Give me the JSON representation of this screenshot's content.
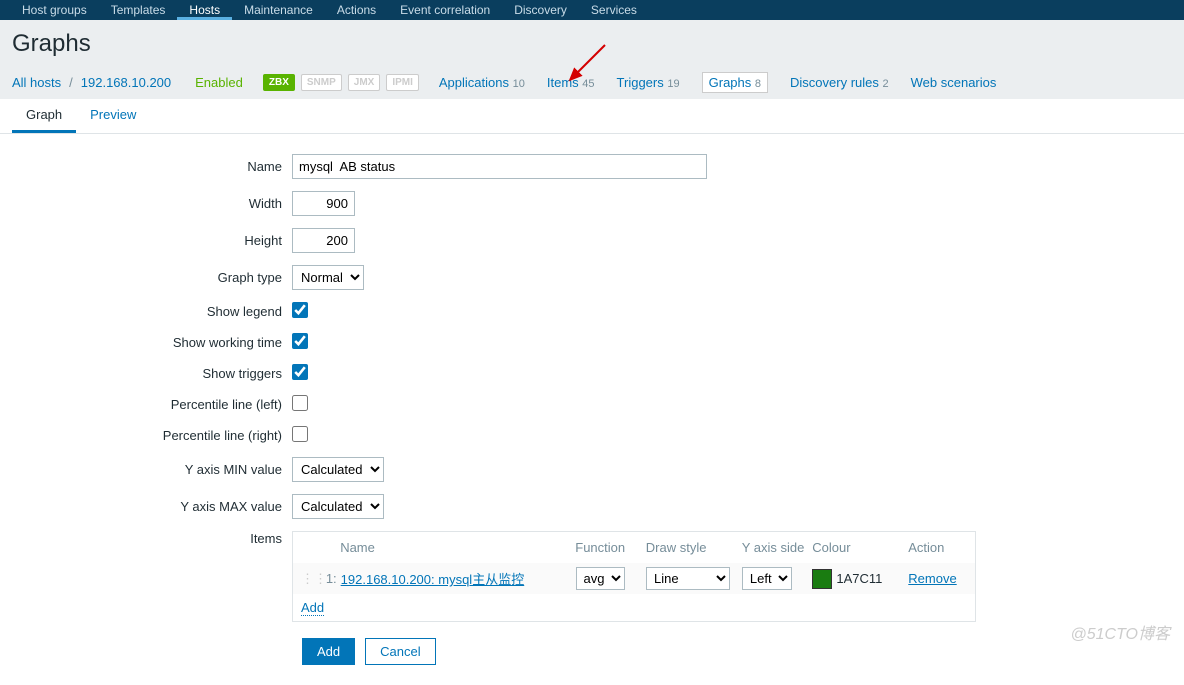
{
  "topnav": {
    "items": [
      "Host groups",
      "Templates",
      "Hosts",
      "Maintenance",
      "Actions",
      "Event correlation",
      "Discovery",
      "Services"
    ],
    "active": 2
  },
  "page_title": "Graphs",
  "breadcrumb": {
    "all_hosts": "All hosts",
    "host": "192.168.10.200",
    "enabled": "Enabled",
    "badges": [
      "ZBX",
      "SNMP",
      "JMX",
      "IPMI"
    ]
  },
  "hostnav": [
    {
      "label": "Applications",
      "count": "10"
    },
    {
      "label": "Items",
      "count": "45"
    },
    {
      "label": "Triggers",
      "count": "19"
    },
    {
      "label": "Graphs",
      "count": "8",
      "boxed": true
    },
    {
      "label": "Discovery rules",
      "count": "2"
    },
    {
      "label": "Web scenarios",
      "count": ""
    }
  ],
  "tabs": {
    "graph": "Graph",
    "preview": "Preview"
  },
  "form": {
    "name_label": "Name",
    "name_value": "mysql  AB status",
    "width_label": "Width",
    "width_value": "900",
    "height_label": "Height",
    "height_value": "200",
    "graphtype_label": "Graph type",
    "graphtype_value": "Normal",
    "showlegend_label": "Show legend",
    "showwork_label": "Show working time",
    "showtrig_label": "Show triggers",
    "percleft_label": "Percentile line (left)",
    "percright_label": "Percentile line (right)",
    "ymin_label": "Y axis MIN value",
    "ymin_value": "Calculated",
    "ymax_label": "Y axis MAX value",
    "ymax_value": "Calculated",
    "items_label": "Items"
  },
  "items_table": {
    "headers": {
      "name": "Name",
      "function": "Function",
      "draw": "Draw style",
      "yaxis": "Y axis side",
      "colour": "Colour",
      "action": "Action"
    },
    "row": {
      "num": "1:",
      "name": "192.168.10.200: mysql主从监控",
      "function": "avg",
      "draw": "Line",
      "yaxis": "Left",
      "colour": "1A7C11",
      "action": "Remove"
    },
    "add_link": "Add"
  },
  "buttons": {
    "add": "Add",
    "cancel": "Cancel"
  },
  "watermark": "@51CTO博客"
}
